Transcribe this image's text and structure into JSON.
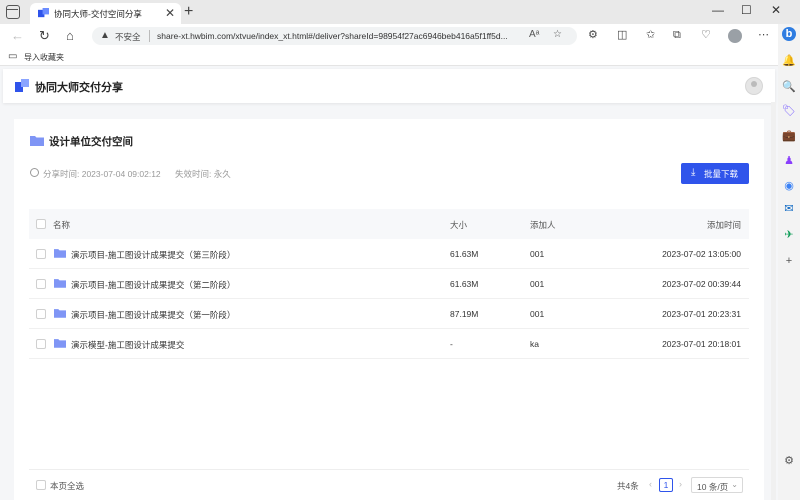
{
  "browser": {
    "tab_title": "协同大师-交付空间分享",
    "tab_close": "✕",
    "new_tab": "+",
    "window_controls": [
      "—",
      "☐",
      "✕"
    ],
    "nav": {
      "back": "←",
      "refresh": "↻",
      "home": "⌂"
    },
    "security_label": "不安全",
    "url": "share-xt.hwbim.com/xtvue/index_xt.html#/deliver?shareId=98954f27ac6946beb416a5f1ff5d...",
    "favorites_item": "导入收藏夹"
  },
  "app": {
    "brand": "协同大师交付分享",
    "space_title": "设计单位交付空间",
    "share_time": "分享时间: 2023-07-04 09:02:12",
    "expire_time": "失效时间: 永久",
    "batch_download": "批量下载",
    "accent_color": "#2f54eb"
  },
  "table": {
    "columns": [
      "名称",
      "大小",
      "添加人",
      "添加时间"
    ],
    "rows": [
      {
        "name": "演示项目-施工图设计成果提交（第三阶段）",
        "size": "61.63M",
        "adder": "001",
        "time": "2023-07-02 13:05:00"
      },
      {
        "name": "演示项目-施工图设计成果提交（第二阶段）",
        "size": "61.63M",
        "adder": "001",
        "time": "2023-07-02 00:39:44"
      },
      {
        "name": "演示项目-施工图设计成果提交（第一阶段）",
        "size": "87.19M",
        "adder": "001",
        "time": "2023-07-01 20:23:31"
      },
      {
        "name": "演示模型-施工图设计成果提交",
        "size": "-",
        "adder": "ka",
        "time": "2023-07-01 20:18:01"
      }
    ]
  },
  "footer": {
    "select_all": "本页全选",
    "total": "共4条",
    "current_page": "1",
    "page_size": "10 条/页"
  }
}
